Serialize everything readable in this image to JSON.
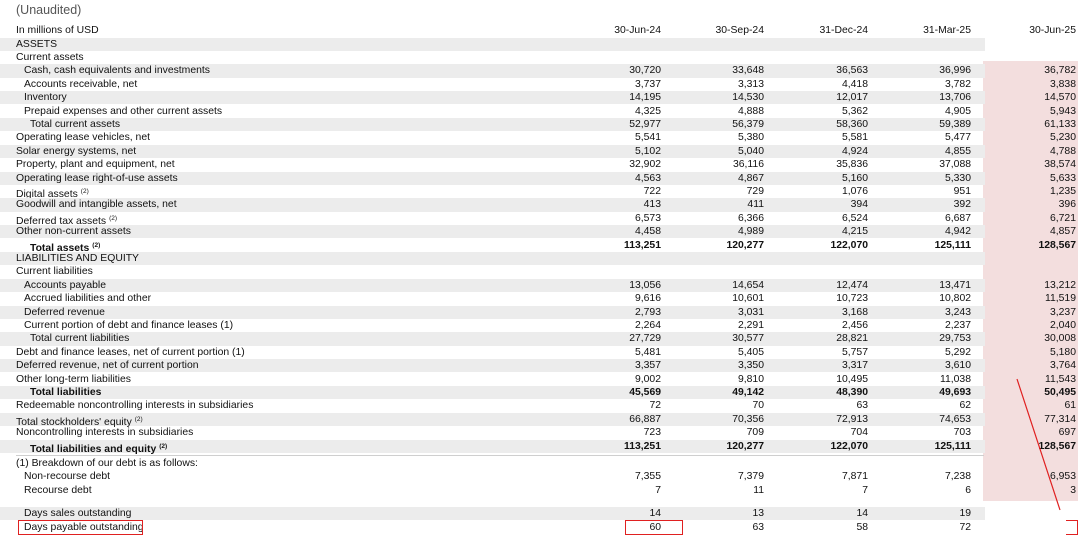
{
  "note": "(Unaudited)",
  "unit_label": "In millions of USD",
  "columns": [
    "30-Jun-24",
    "30-Sep-24",
    "31-Dec-24",
    "31-Mar-25",
    "30-Jun-25"
  ],
  "rows": [
    {
      "label": "ASSETS",
      "indent": 0,
      "bold": false,
      "values": []
    },
    {
      "label": "Current assets",
      "indent": 0,
      "bold": false,
      "values": []
    },
    {
      "label": "Cash, cash equivalents and investments",
      "indent": 1,
      "bold": false,
      "values": [
        "30,720",
        "33,648",
        "36,563",
        "36,996",
        "36,782"
      ]
    },
    {
      "label": "Accounts receivable, net",
      "indent": 1,
      "bold": false,
      "values": [
        "3,737",
        "3,313",
        "4,418",
        "3,782",
        "3,838"
      ]
    },
    {
      "label": "Inventory",
      "indent": 1,
      "bold": false,
      "values": [
        "14,195",
        "14,530",
        "12,017",
        "13,706",
        "14,570"
      ]
    },
    {
      "label": "Prepaid expenses and other current assets",
      "indent": 1,
      "bold": false,
      "values": [
        "4,325",
        "4,888",
        "5,362",
        "4,905",
        "5,943"
      ]
    },
    {
      "label": "Total current assets",
      "indent": 2,
      "bold": false,
      "values": [
        "52,977",
        "56,379",
        "58,360",
        "59,389",
        "61,133"
      ]
    },
    {
      "label": "Operating lease vehicles, net",
      "indent": 0,
      "bold": false,
      "values": [
        "5,541",
        "5,380",
        "5,581",
        "5,477",
        "5,230"
      ]
    },
    {
      "label": "Solar energy systems, net",
      "indent": 0,
      "bold": false,
      "values": [
        "5,102",
        "5,040",
        "4,924",
        "4,855",
        "4,788"
      ]
    },
    {
      "label": "Property, plant and equipment, net",
      "indent": 0,
      "bold": false,
      "values": [
        "32,902",
        "36,116",
        "35,836",
        "37,088",
        "38,574"
      ]
    },
    {
      "label": "Operating lease right-of-use assets",
      "indent": 0,
      "bold": false,
      "values": [
        "4,563",
        "4,867",
        "5,160",
        "5,330",
        "5,633"
      ]
    },
    {
      "label": "Digital assets",
      "sup": "(2)",
      "indent": 0,
      "bold": false,
      "values": [
        "722",
        "729",
        "1,076",
        "951",
        "1,235"
      ]
    },
    {
      "label": "Goodwill and intangible assets, net",
      "indent": 0,
      "bold": false,
      "values": [
        "413",
        "411",
        "394",
        "392",
        "396"
      ]
    },
    {
      "label": "Deferred tax assets",
      "sup": "(2)",
      "indent": 0,
      "bold": false,
      "values": [
        "6,573",
        "6,366",
        "6,524",
        "6,687",
        "6,721"
      ]
    },
    {
      "label": "Other non-current assets",
      "indent": 0,
      "bold": false,
      "values": [
        "4,458",
        "4,989",
        "4,215",
        "4,942",
        "4,857"
      ]
    },
    {
      "label": "Total assets",
      "sup": "(2)",
      "indent": 2,
      "bold": true,
      "values": [
        "113,251",
        "120,277",
        "122,070",
        "125,111",
        "128,567"
      ]
    },
    {
      "label": "LIABILITIES AND EQUITY",
      "indent": 0,
      "bold": false,
      "values": []
    },
    {
      "label": "Current liabilities",
      "indent": 0,
      "bold": false,
      "values": []
    },
    {
      "label": "Accounts payable",
      "indent": 1,
      "bold": false,
      "values": [
        "13,056",
        "14,654",
        "12,474",
        "13,471",
        "13,212"
      ]
    },
    {
      "label": "Accrued liabilities and other",
      "indent": 1,
      "bold": false,
      "values": [
        "9,616",
        "10,601",
        "10,723",
        "10,802",
        "11,519"
      ]
    },
    {
      "label": "Deferred revenue",
      "indent": 1,
      "bold": false,
      "values": [
        "2,793",
        "3,031",
        "3,168",
        "3,243",
        "3,237"
      ]
    },
    {
      "label": "Current portion of debt and finance leases (1)",
      "indent": 1,
      "bold": false,
      "values": [
        "2,264",
        "2,291",
        "2,456",
        "2,237",
        "2,040"
      ]
    },
    {
      "label": "Total current liabilities",
      "indent": 2,
      "bold": false,
      "values": [
        "27,729",
        "30,577",
        "28,821",
        "29,753",
        "30,008"
      ]
    },
    {
      "label": "Debt and finance leases, net of current portion (1)",
      "indent": 0,
      "bold": false,
      "values": [
        "5,481",
        "5,405",
        "5,757",
        "5,292",
        "5,180"
      ]
    },
    {
      "label": "Deferred revenue, net of current portion",
      "indent": 0,
      "bold": false,
      "values": [
        "3,357",
        "3,350",
        "3,317",
        "3,610",
        "3,764"
      ]
    },
    {
      "label": "Other long-term liabilities",
      "indent": 0,
      "bold": false,
      "values": [
        "9,002",
        "9,810",
        "10,495",
        "11,038",
        "11,543"
      ]
    },
    {
      "label": "Total liabilities",
      "indent": 2,
      "bold": true,
      "values": [
        "45,569",
        "49,142",
        "48,390",
        "49,693",
        "50,495"
      ]
    },
    {
      "label": "Redeemable noncontrolling interests in subsidiaries",
      "indent": 0,
      "bold": false,
      "values": [
        "72",
        "70",
        "63",
        "62",
        "61"
      ]
    },
    {
      "label": "Total stockholders' equity",
      "sup": "(2)",
      "indent": 0,
      "bold": false,
      "values": [
        "66,887",
        "70,356",
        "72,913",
        "74,653",
        "77,314"
      ]
    },
    {
      "label": "Noncontrolling interests in subsidiaries",
      "indent": 0,
      "bold": false,
      "values": [
        "723",
        "709",
        "704",
        "703",
        "697"
      ]
    },
    {
      "label": "Total liabilities and equity",
      "sup": "(2)",
      "indent": 2,
      "bold": true,
      "values": [
        "113,251",
        "120,277",
        "122,070",
        "125,111",
        "128,567"
      ]
    }
  ],
  "debt_breakdown": {
    "title": "(1) Breakdown of our debt is as follows:",
    "rows": [
      {
        "label": "Non-recourse debt",
        "values": [
          "7,355",
          "7,379",
          "7,871",
          "7,238",
          "6,953"
        ]
      },
      {
        "label": "Recourse debt",
        "values": [
          "7",
          "11",
          "7",
          "6",
          "3"
        ]
      }
    ]
  },
  "metrics": [
    {
      "label": "Days sales outstanding",
      "values": [
        "14",
        "13",
        "14",
        "19",
        ""
      ]
    },
    {
      "label": "Days payable outstanding",
      "values": [
        "60",
        "63",
        "58",
        "72",
        ""
      ]
    }
  ],
  "colors": {
    "highlight": "#f3dede",
    "annotation": "#e02020",
    "band": "#ececec"
  }
}
